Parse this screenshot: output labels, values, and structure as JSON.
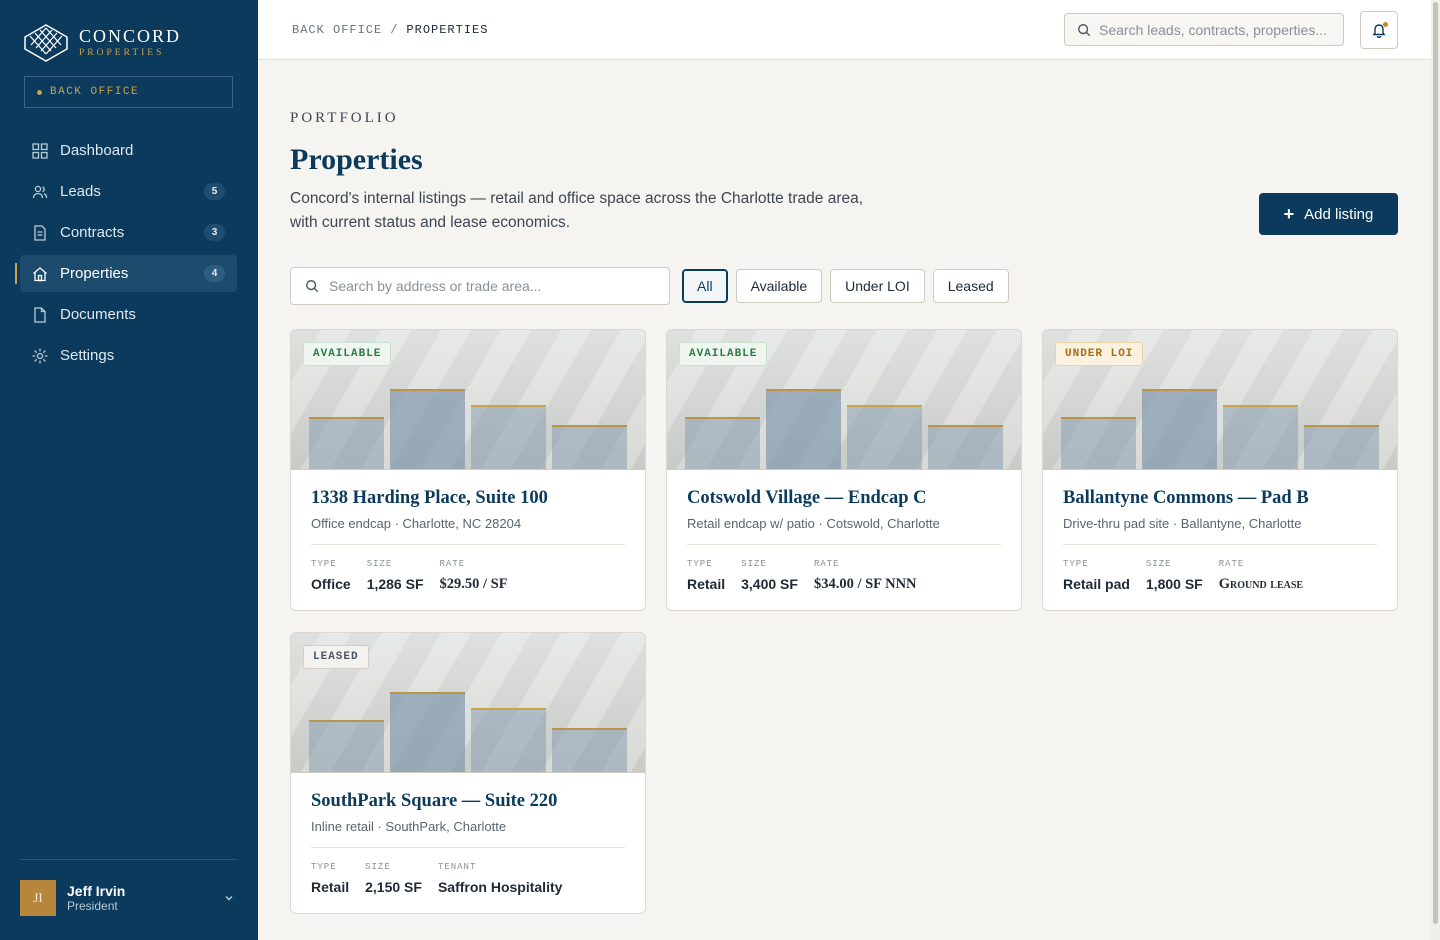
{
  "brand": {
    "name": "CONCORD",
    "sub": "PROPERTIES"
  },
  "section_badge": "BACK OFFICE",
  "nav": [
    {
      "label": "Dashboard",
      "icon": "grid-icon"
    },
    {
      "label": "Leads",
      "icon": "users-icon",
      "count": "5"
    },
    {
      "label": "Contracts",
      "icon": "file-icon",
      "count": "3"
    },
    {
      "label": "Properties",
      "icon": "home-icon",
      "count": "4",
      "active": true
    },
    {
      "label": "Documents",
      "icon": "document-icon"
    },
    {
      "label": "Settings",
      "icon": "gear-icon"
    }
  ],
  "user": {
    "initials": "JI",
    "name": "Jeff Irvin",
    "role": "President"
  },
  "breadcrumb": {
    "parent": "BACK OFFICE",
    "separator": "/",
    "current": "PROPERTIES"
  },
  "top_search": {
    "placeholder": "Search leads, contracts, properties..."
  },
  "page": {
    "eyebrow": "PORTFOLIO",
    "title": "Properties",
    "description": "Concord's internal listings — retail and office space across the Charlotte trade area, with current status and lease economics.",
    "add_button": "Add listing"
  },
  "filter": {
    "search_placeholder": "Search by address or trade area...",
    "chips": [
      "All",
      "Available",
      "Under LOI",
      "Leased"
    ],
    "active": "All"
  },
  "listings": [
    {
      "status": "AVAILABLE",
      "title": "1338 Harding Place, Suite 100",
      "subtitle": "Office endcap · Charlotte, NC 28204",
      "specs": [
        {
          "label": "TYPE",
          "value": "Office"
        },
        {
          "label": "SIZE",
          "value": "1,286 SF"
        },
        {
          "label": "RATE",
          "value": "$29.50 / SF"
        }
      ]
    },
    {
      "status": "AVAILABLE",
      "title": "Cotswold Village — Endcap C",
      "subtitle": "Retail endcap w/ patio · Cotswold, Charlotte",
      "specs": [
        {
          "label": "TYPE",
          "value": "Retail"
        },
        {
          "label": "SIZE",
          "value": "3,400 SF"
        },
        {
          "label": "RATE",
          "value": "$34.00 / SF NNN"
        }
      ]
    },
    {
      "status": "UNDER LOI",
      "title": "Ballantyne Commons — Pad B",
      "subtitle": "Drive-thru pad site · Ballantyne, Charlotte",
      "specs": [
        {
          "label": "TYPE",
          "value": "Retail pad"
        },
        {
          "label": "SIZE",
          "value": "1,800 SF"
        },
        {
          "label": "RATE",
          "value": "Ground lease"
        }
      ]
    },
    {
      "status": "LEASED",
      "title": "SouthPark Square — Suite 220",
      "subtitle": "Inline retail · SouthPark, Charlotte",
      "specs": [
        {
          "label": "TYPE",
          "value": "Retail"
        },
        {
          "label": "SIZE",
          "value": "2,150 SF"
        },
        {
          "label": "TENANT",
          "value": "Saffron Hospitality"
        }
      ]
    }
  ],
  "colors": {
    "navy": "#0b3a5c",
    "gold": "#c9a24a",
    "available": "#2e7a45",
    "under_loi": "#a86a12"
  }
}
